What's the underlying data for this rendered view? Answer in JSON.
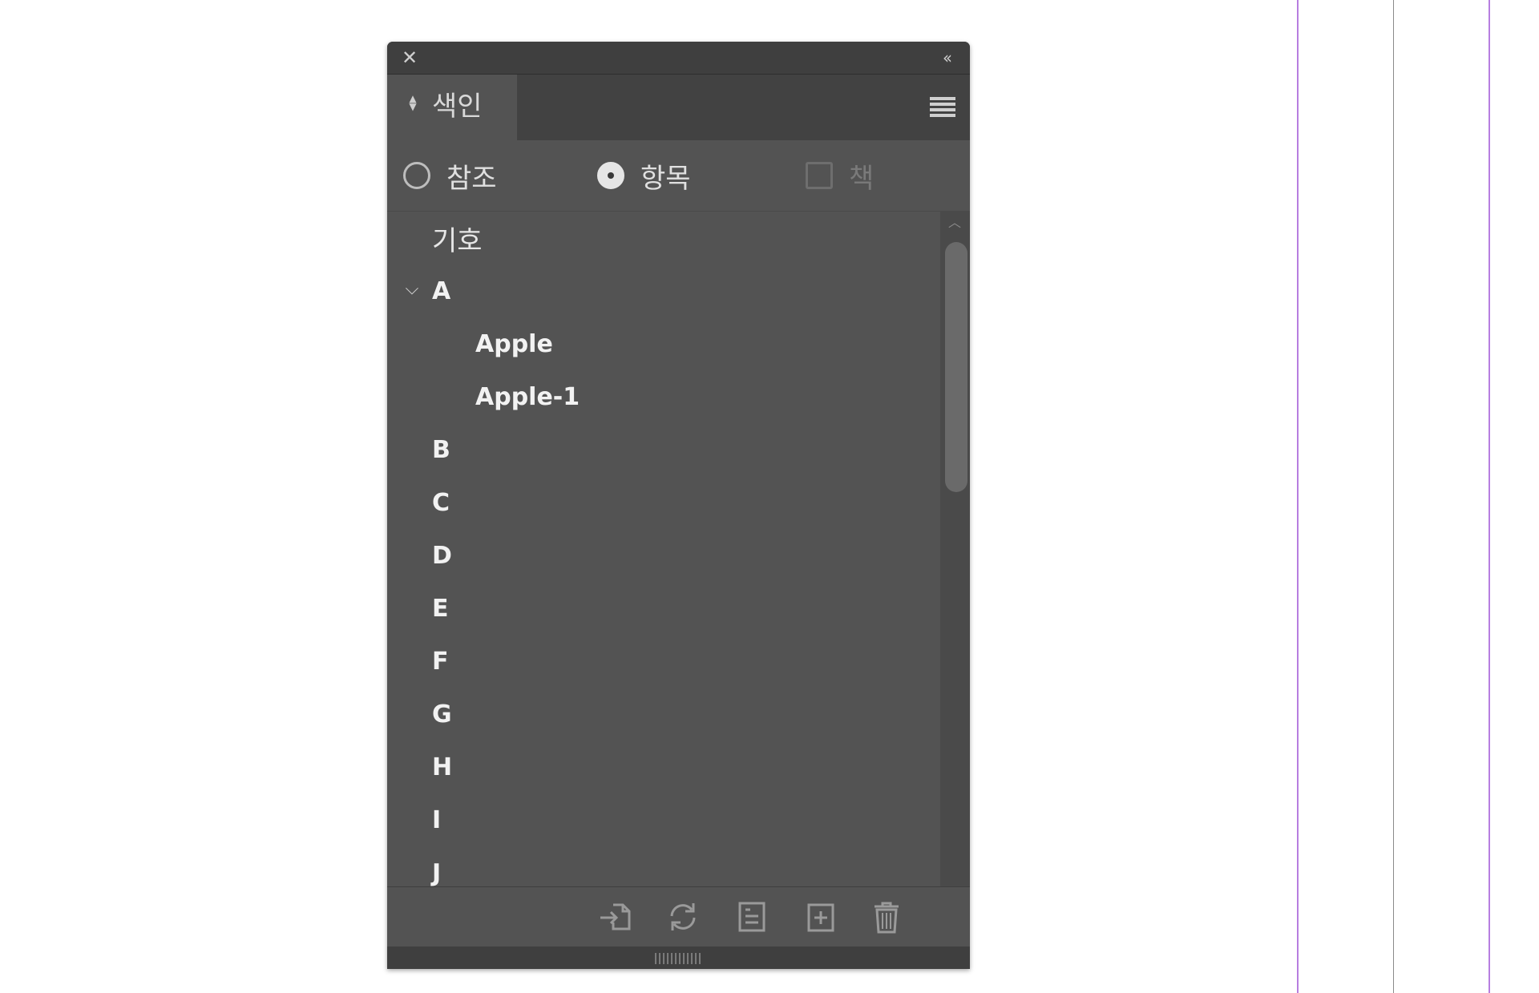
{
  "panel": {
    "tab_label": "색인",
    "close_glyph": "✕",
    "collapse_glyph": "‹‹"
  },
  "options": {
    "reference_label": "참조",
    "topic_label": "항목",
    "book_label": "책",
    "selected": "topic"
  },
  "list": {
    "symbols_label": "기호",
    "items": [
      {
        "label": "A",
        "level": 0,
        "expanded": true
      },
      {
        "label": "Apple",
        "level": 1
      },
      {
        "label": "Apple-1",
        "level": 1
      },
      {
        "label": "B",
        "level": 0
      },
      {
        "label": "C",
        "level": 0
      },
      {
        "label": "D",
        "level": 0
      },
      {
        "label": "E",
        "level": 0
      },
      {
        "label": "F",
        "level": 0
      },
      {
        "label": "G",
        "level": 0
      },
      {
        "label": "H",
        "level": 0
      },
      {
        "label": "I",
        "level": 0
      },
      {
        "label": "J",
        "level": 0
      }
    ]
  },
  "footer": {
    "icons": [
      "go-to-marker-icon",
      "refresh-icon",
      "new-topic-icon",
      "new-entry-icon",
      "delete-icon"
    ]
  },
  "colors": {
    "panel_bg": "#535353",
    "titlebar_bg": "#3f3f3f",
    "guide_purple": "#b77ee0"
  }
}
